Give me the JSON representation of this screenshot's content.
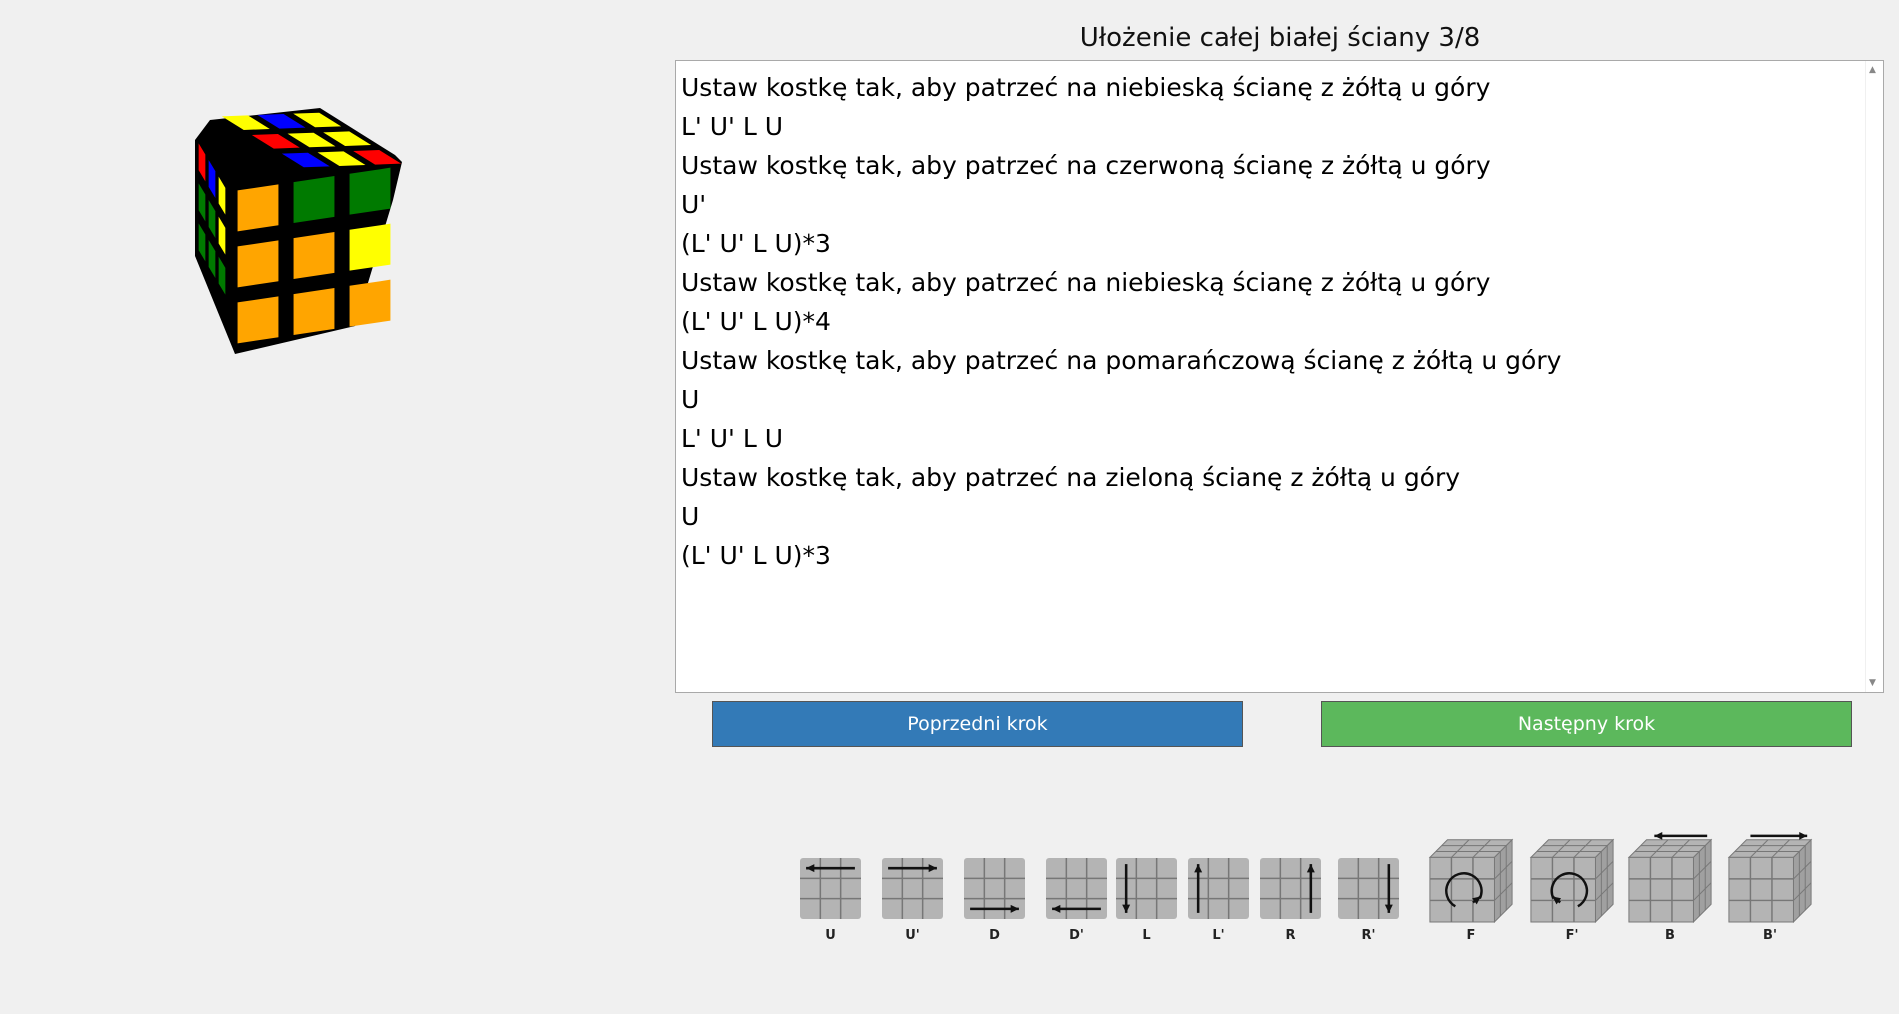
{
  "title": "Ułożenie całej białej ściany 3/8",
  "instructions": [
    "Ustaw kostkę tak, aby patrzeć na niebieską ścianę z żółtą u góry",
    "L' U' L U",
    "Ustaw kostkę tak, aby patrzeć na czerwoną ścianę z żółtą u góry",
    "U'",
    "(L' U' L U)*3",
    "Ustaw kostkę tak, aby patrzeć na niebieską ścianę z żółtą u góry",
    "(L' U' L U)*4",
    "Ustaw kostkę tak, aby patrzeć na pomarańczową ścianę z żółtą u góry",
    "U",
    "L' U' L U",
    "Ustaw kostkę tak, aby patrzeć na zieloną ścianę z żółtą u góry",
    "U",
    "(L' U' L U)*3"
  ],
  "buttons": {
    "prev": "Poprzedni krok",
    "next": "Następny krok"
  },
  "colors": {
    "prev_button": "#337ab7",
    "next_button": "#5cb85c",
    "yellow": "#ffff00",
    "blue": "#0000ff",
    "red": "#ff0000",
    "green": "#007a00",
    "orange": "#ffa500",
    "sticker_gray": "#b4b4b4"
  },
  "cube": {
    "top": [
      [
        "yellow",
        "blue",
        "yellow"
      ],
      [
        "red",
        "yellow",
        "yellow"
      ],
      [
        "blue",
        "yellow",
        "red"
      ]
    ],
    "front": [
      [
        "orange",
        "green",
        "green"
      ],
      [
        "orange",
        "orange",
        "yellow"
      ],
      [
        "orange",
        "orange",
        "orange"
      ]
    ],
    "side": [
      [
        "red",
        "blue",
        "yellow"
      ],
      [
        "green",
        "green",
        "yellow"
      ],
      [
        "green",
        "green",
        "green"
      ]
    ]
  },
  "moves": [
    {
      "label": "U",
      "icon": "move-u-icon"
    },
    {
      "label": "U'",
      "icon": "move-u-prime-icon"
    },
    {
      "label": "D",
      "icon": "move-d-icon"
    },
    {
      "label": "D'",
      "icon": "move-d-prime-icon"
    },
    {
      "label": "L",
      "icon": "move-l-icon"
    },
    {
      "label": "L'",
      "icon": "move-l-prime-icon"
    },
    {
      "label": "R",
      "icon": "move-r-icon"
    },
    {
      "label": "R'",
      "icon": "move-r-prime-icon"
    },
    {
      "label": "F",
      "icon": "move-f-icon"
    },
    {
      "label": "F'",
      "icon": "move-f-prime-icon"
    },
    {
      "label": "B",
      "icon": "move-b-icon"
    },
    {
      "label": "B'",
      "icon": "move-b-prime-icon"
    }
  ]
}
